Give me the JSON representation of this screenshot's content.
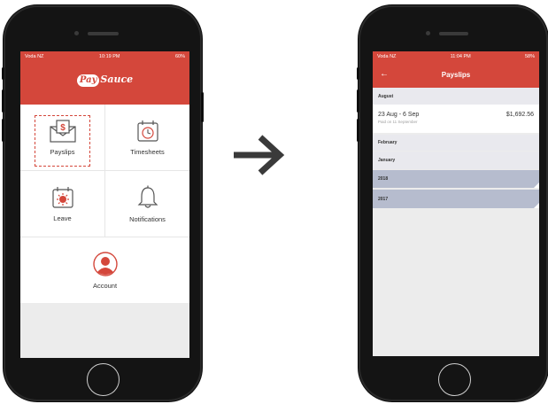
{
  "left_phone": {
    "status": {
      "carrier": "Voda NZ",
      "time": "10:19 PM",
      "battery": "60%"
    },
    "logo": {
      "pay": "Pay",
      "rest": "Sauce"
    },
    "menu": [
      {
        "label": "Payslips",
        "icon": "payslip-envelope-icon",
        "selected": true
      },
      {
        "label": "Timesheets",
        "icon": "clock-calendar-icon"
      },
      {
        "label": "Leave",
        "icon": "sun-calendar-icon"
      },
      {
        "label": "Notifications",
        "icon": "bell-icon"
      },
      {
        "label": "Account",
        "icon": "account-icon"
      }
    ]
  },
  "right_phone": {
    "status": {
      "carrier": "Voda NZ",
      "time": "11:04 PM",
      "battery": "58%"
    },
    "title": "Payslips",
    "sections": [
      {
        "label": "August"
      },
      {
        "label": "February"
      },
      {
        "label": "January"
      },
      {
        "label": "2018"
      },
      {
        "label": "2017"
      }
    ],
    "payslip": {
      "period": "23 Aug - 6 Sep",
      "paid": "Paid on 11 September",
      "amount": "$1,692.56"
    }
  },
  "colors": {
    "brand_red": "#d4473b",
    "year_row": "#b6bcce",
    "arrow": "#3a3a3a"
  }
}
